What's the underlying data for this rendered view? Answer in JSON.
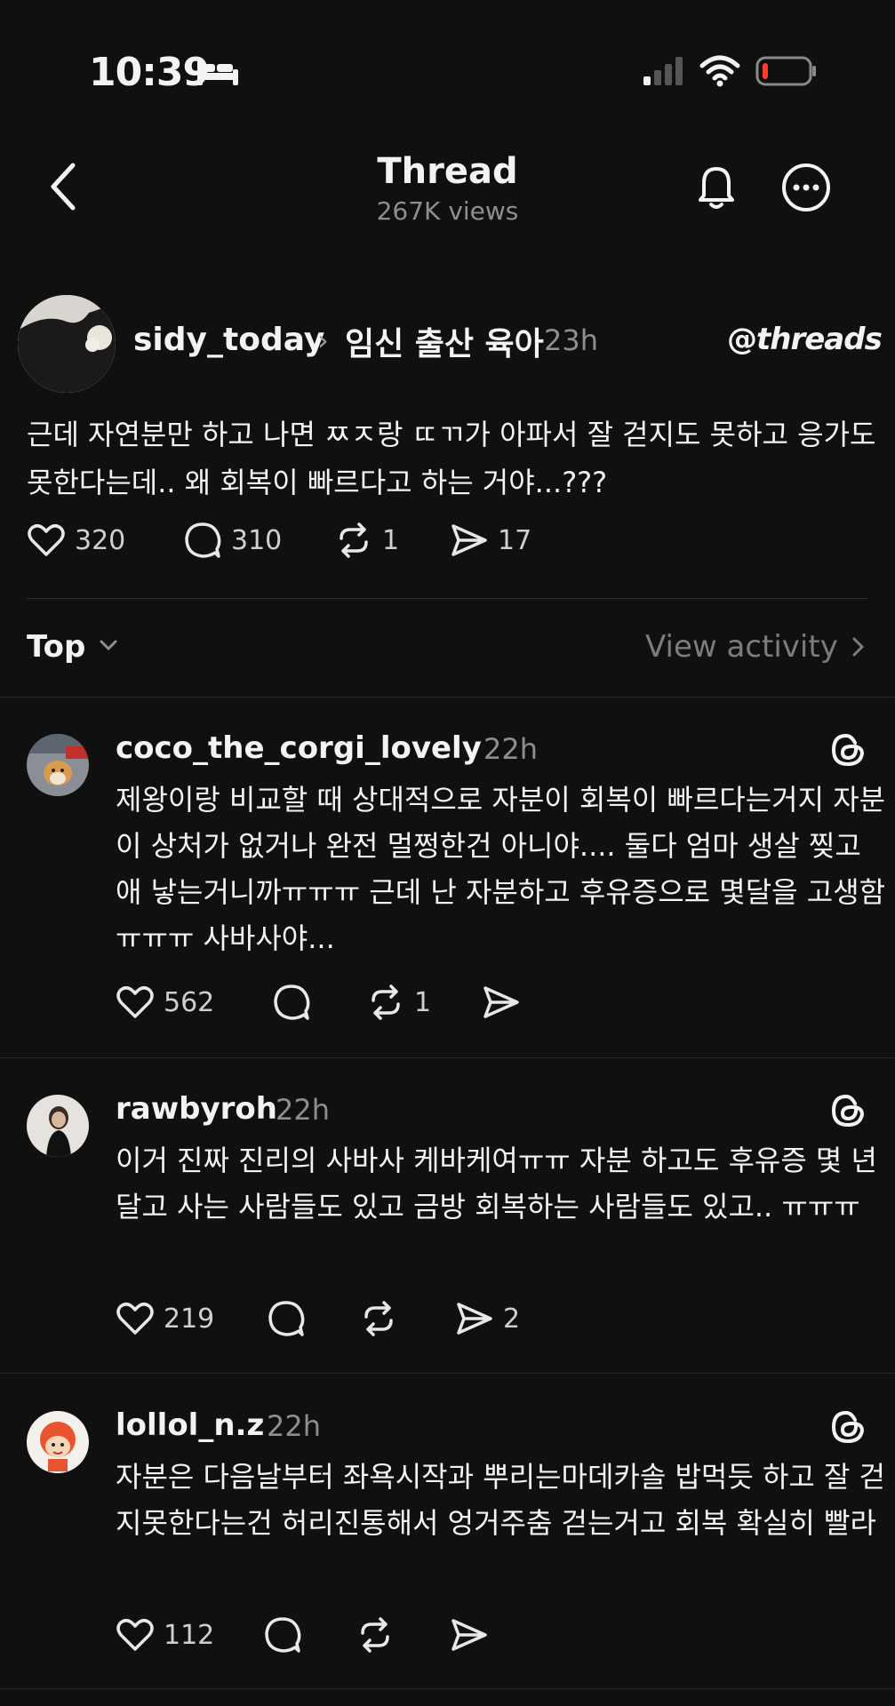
{
  "status_bar": {
    "time": "10:39"
  },
  "header": {
    "title": "Thread",
    "views": "267K views"
  },
  "post": {
    "username": "sidy_today",
    "community": "임신 출산 육아",
    "time": "23h",
    "brand": "threads",
    "text": "근데 자연분만 하고 나면 ㅉㅈ랑 ㄸㄲ가 아파서 잘 걷지도 못하고 응가도 못한다는데.. 왜 회복이 빠르다고 하는 거야...???",
    "likes": "320",
    "comments": "310",
    "reposts": "1",
    "shares": "17"
  },
  "sort": {
    "label": "Top",
    "view_activity": "View activity"
  },
  "replies": [
    {
      "username": "coco_the_corgi_lovely",
      "time": "22h",
      "text": "제왕이랑 비교할 때 상대적으로 자분이 회복이 빠르다는거지 자분이 상처가 없거나 완전 멀쩡한건 아니야.... 둘다 엄마 생살 찢고 애 낳는거니까ㅠㅠㅠ 근데 난 자분하고 후유증으로 몇달을 고생함ㅠㅠㅠ 사바사야...",
      "likes": "562",
      "comments": "",
      "reposts": "1",
      "shares": ""
    },
    {
      "username": "rawbyroh",
      "time": "22h",
      "text": "이거 진짜 진리의 사바사 케바케여ㅠㅠ 자분 하고도 후유증 몇 년 달고 사는 사람들도 있고 금방 회복하는 사람들도 있고.. ㅠㅠㅠ",
      "likes": "219",
      "comments": "",
      "reposts": "",
      "shares": "2"
    },
    {
      "username": "lollol_n.z",
      "time": "22h",
      "text": "자분은 다음날부터 좌욕시작과 뿌리는마데카솔 밥먹듯 하고 잘 걷지못한다는건 허리진통해서 엉거주춤 걷는거고 회복 확실히 빨라",
      "likes": "112",
      "comments": "",
      "reposts": "",
      "shares": ""
    }
  ]
}
